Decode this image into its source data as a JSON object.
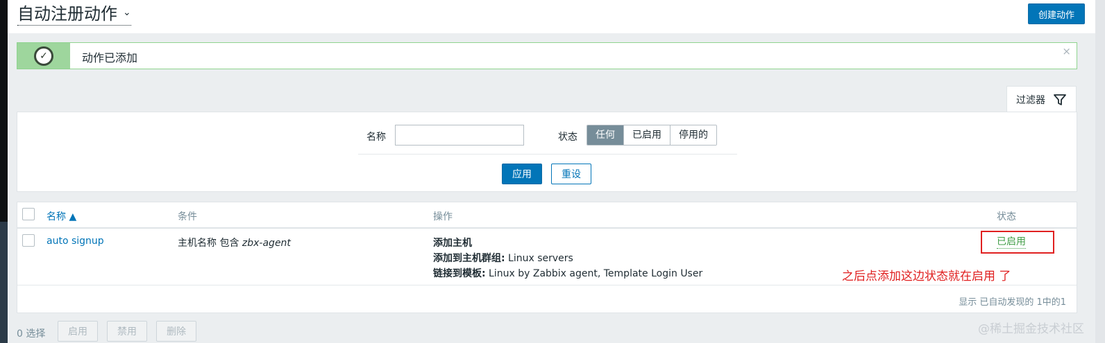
{
  "header": {
    "title": "自动注册动作",
    "title_chevron": "⌄",
    "create_button": "创建动作"
  },
  "message": {
    "text": "动作已添加",
    "icon": "check-circle-icon",
    "close": "×"
  },
  "filter": {
    "tab_label": "过滤器",
    "name_label": "名称",
    "name_value": "",
    "status_label": "状态",
    "status_options": [
      "任何",
      "已启用",
      "停用的"
    ],
    "status_selected": "任何",
    "apply_label": "应用",
    "reset_label": "重设"
  },
  "table": {
    "headers": {
      "name": "名称 ▲",
      "conditions": "条件",
      "operations": "操作",
      "status": "状态"
    },
    "rows": [
      {
        "name": "auto signup",
        "condition_prefix": "主机名称 包含 ",
        "condition_value": "zbx-agent",
        "operations": [
          {
            "label": "添加主机",
            "value": ""
          },
          {
            "label": "添加到主机群组:",
            "value": " Linux servers"
          },
          {
            "label": "链接到模板:",
            "value": " Linux by Zabbix agent, Template Login User"
          }
        ],
        "status": "已启用"
      }
    ],
    "paging": "显示 已自动发现的 1中的1"
  },
  "annotation": "之后点添加这边状态就在启用 了",
  "bottom": {
    "selected": "0 选择",
    "enable": "启用",
    "disable": "禁用",
    "delete": "删除"
  },
  "watermark": "@稀土掘金技术社区",
  "colors": {
    "primary": "#0275b8",
    "enabled": "#429e47",
    "success_bar": "#9ed69d",
    "annotation": "#e02020"
  }
}
